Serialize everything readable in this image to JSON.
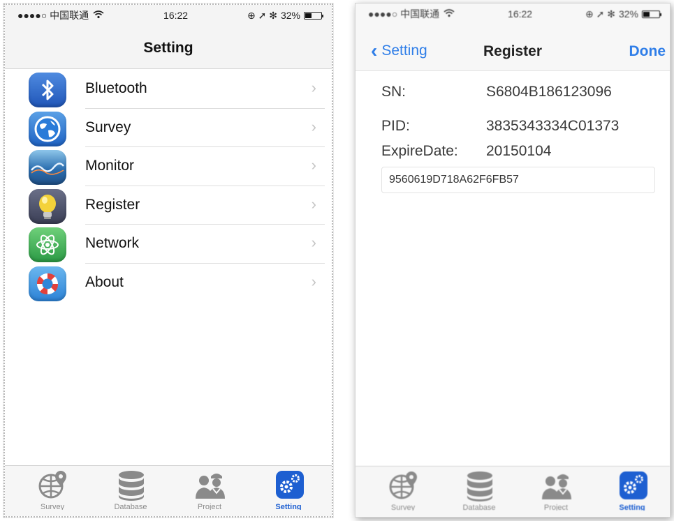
{
  "left_screen": {
    "status_bar": {
      "carrier": "●●●●○ 中国联通",
      "wifi_icon": "wifi-icon",
      "time": "16:22",
      "status_icons": "⊕ ➚ ✻",
      "battery": "32%"
    },
    "title": "Setting",
    "items": [
      {
        "label": "Bluetooth",
        "icon": "bluetooth-icon"
      },
      {
        "label": "Survey",
        "icon": "globe-icon"
      },
      {
        "label": "Monitor",
        "icon": "monitor-wave-icon"
      },
      {
        "label": "Register",
        "icon": "lightbulb-icon"
      },
      {
        "label": "Network",
        "icon": "atom-icon"
      },
      {
        "label": "About",
        "icon": "lifebuoy-icon"
      }
    ],
    "tabs": [
      {
        "label": "Survey",
        "icon": "globe-pin-icon"
      },
      {
        "label": "Database",
        "icon": "database-icon"
      },
      {
        "label": "Project",
        "icon": "workers-icon"
      },
      {
        "label": "Setting",
        "icon": "gear-icon",
        "active": true
      }
    ]
  },
  "right_screen": {
    "status_bar": {
      "carrier": "●●●●○ 中国联通",
      "wifi_icon": "wifi-icon",
      "time": "16:22",
      "status_icons": "⊕ ➚ ✻",
      "battery": "32%"
    },
    "back_label": "Setting",
    "title": "Register",
    "done_label": "Done",
    "fields": [
      {
        "label": "SN:",
        "value": "S6804B186123096"
      },
      {
        "label": "PID:",
        "value": "3835343334C01373"
      },
      {
        "label": "ExpireDate:",
        "value": "20150104"
      }
    ],
    "register_code": "9560619D718A62F6FB57",
    "tabs": [
      {
        "label": "Survey",
        "icon": "globe-pin-icon"
      },
      {
        "label": "Database",
        "icon": "database-icon"
      },
      {
        "label": "Project",
        "icon": "workers-icon"
      },
      {
        "label": "Setting",
        "icon": "gear-icon",
        "active": true
      }
    ]
  },
  "colors": {
    "accent_blue": "#2f7ee8",
    "active_tab_blue": "#1d5fd1",
    "separator": "#dcdcdc"
  }
}
